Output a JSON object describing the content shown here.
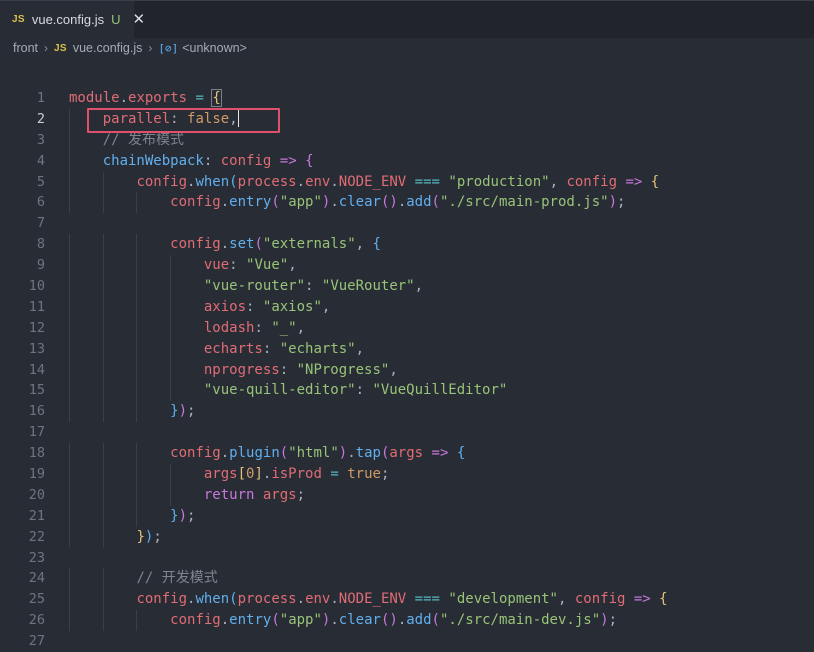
{
  "tab": {
    "badge": "JS",
    "title": "vue.config.js",
    "status": "U",
    "close_glyph": "✕"
  },
  "breadcrumb": {
    "folder": "front",
    "file_badge": "JS",
    "file": "vue.config.js",
    "symbol_icon": "[⊘]",
    "symbol": "<unknown>"
  },
  "editor": {
    "active_line": 2,
    "line_numbers": [
      "1",
      "2",
      "3",
      "4",
      "5",
      "6",
      "7",
      "8",
      "9",
      "10",
      "11",
      "12",
      "13",
      "14",
      "15",
      "16",
      "17",
      "18",
      "19",
      "20",
      "21",
      "22",
      "23",
      "24",
      "25",
      "26",
      "27"
    ]
  },
  "colors": {
    "background": "#282c34",
    "highlight_box": "#e0506c"
  }
}
